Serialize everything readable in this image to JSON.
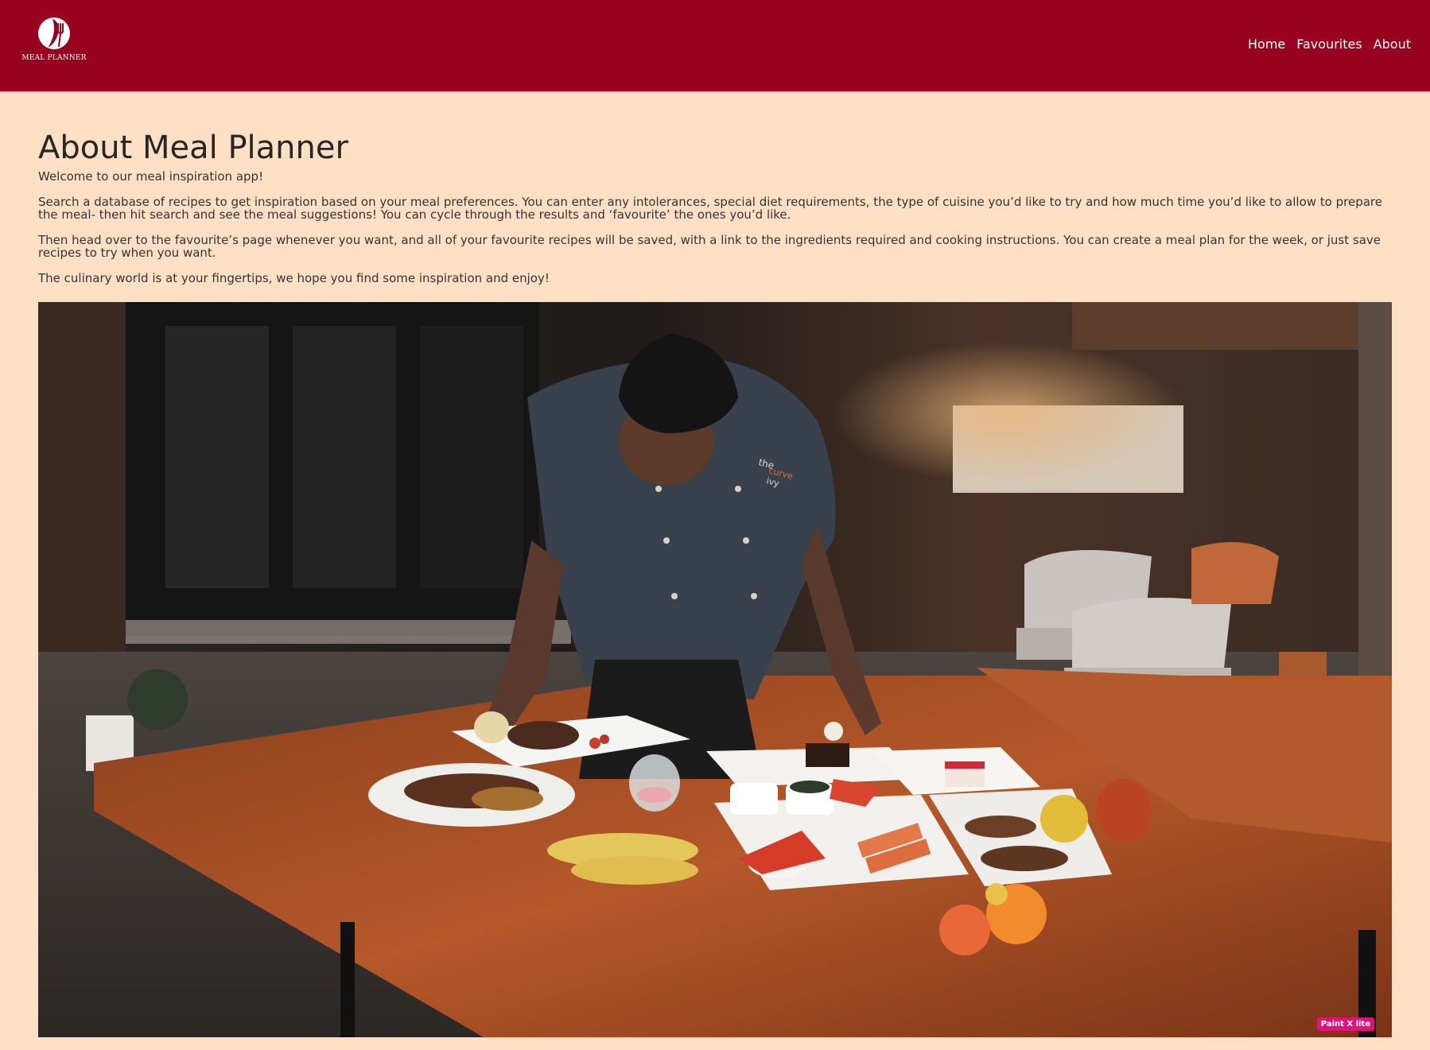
{
  "brand": {
    "logo_text": "MEAL PLANNER",
    "logo_icon": "plate-fork-leaf-icon",
    "header_color": "#98021f",
    "background_color": "#ffe0c4"
  },
  "nav": {
    "items": [
      {
        "label": "Home"
      },
      {
        "label": "Favourites"
      },
      {
        "label": "About"
      }
    ]
  },
  "about": {
    "title": "About Meal Planner",
    "paragraphs": [
      "Welcome to our meal inspiration app!",
      "Search a database of recipes to get inspiration based on your meal preferences. You can enter any intolerances, special diet requirements, the type of cuisine you’d like to try and how much time you’d like to allow to prepare the meal- then hit search and see the meal suggestions! You can cycle through the results and ‘favourite’ the ones you’d like.",
      "Then head over to the favourite’s page whenever you want, and all of your favourite recipes will be saved, with a link to the ingredients required and cooking instructions. You can create a meal plan for the week, or just save recipes to try when you want.",
      "The culinary world is at your fingertips, we hope you find some inspiration and enjoy!"
    ]
  },
  "hero_image": {
    "badge_text": "Paint X lite"
  }
}
